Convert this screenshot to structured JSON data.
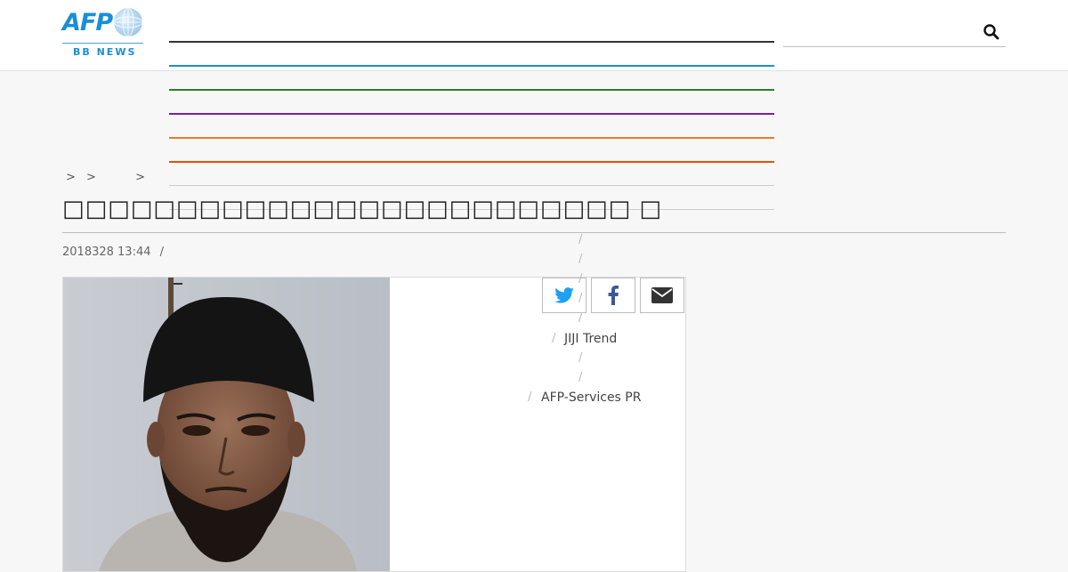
{
  "brand": {
    "logo_text": "AFP",
    "logo_sub": "BB NEWS",
    "accent": "#1a8fd6"
  },
  "menu": {
    "line_colors": [
      "#333333",
      "#1a8fd6",
      "#2e7d32",
      "#7b1fa2",
      "#e67e22",
      "#e65100",
      "#cccccc",
      "#cccccc"
    ]
  },
  "search": {
    "placeholder": "",
    "icon": "search-icon"
  },
  "breadcrumb": {
    "items": [
      "",
      "",
      ""
    ],
    "separator": ">"
  },
  "article": {
    "title": "□□□□□□□□□□□□□□□□□□□□□□□□□ □",
    "date": "2018328 13:44",
    "meta_separator": "/"
  },
  "share": {
    "twitter_icon": "twitter-icon",
    "facebook_icon": "facebook-icon",
    "email_icon": "envelope-icon"
  },
  "side_links": {
    "separator": "/",
    "items": [
      "",
      "",
      "",
      "",
      "",
      "JIJI Trend",
      "",
      "",
      "AFP-Services PR"
    ]
  }
}
